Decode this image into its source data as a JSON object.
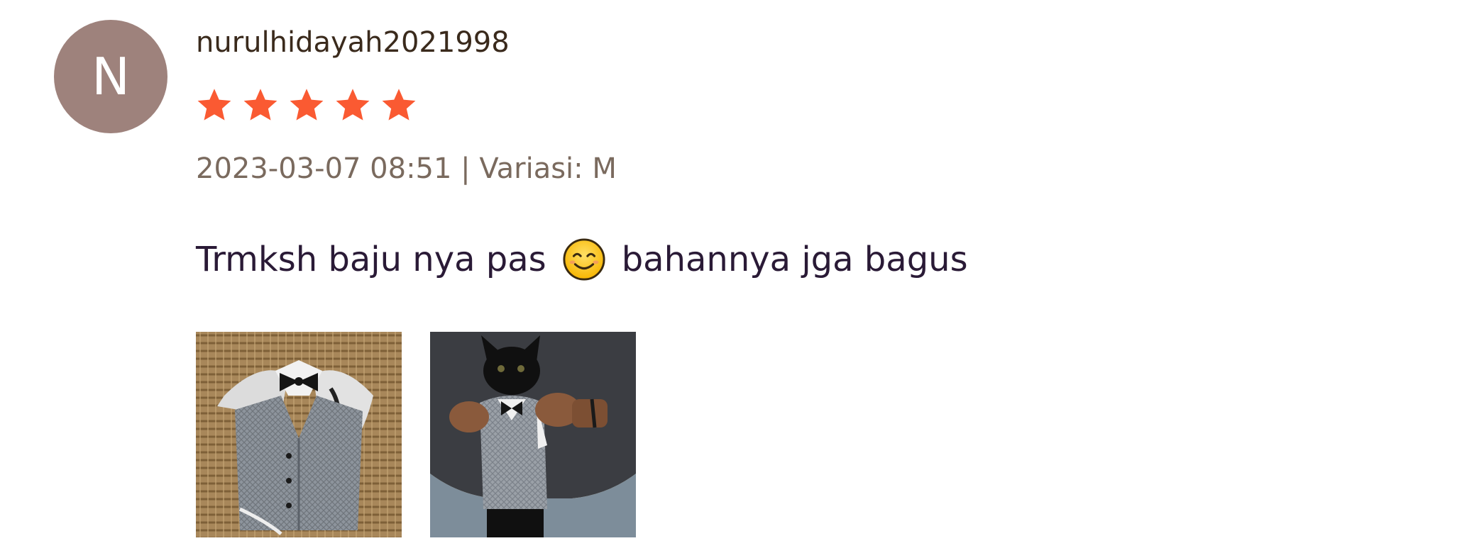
{
  "review": {
    "avatar_letter": "N",
    "username": "nurulhidayah2021998",
    "rating": 5,
    "date": "2023-03-07 08:51",
    "separator": "|",
    "variation": "Variasi: M",
    "comment_part1": "Trmksh baju nya pas",
    "comment_emoji": "smiling-face-icon",
    "comment_part2": "bahannya jga bagus",
    "photos": [
      {
        "name": "review-photo-1"
      },
      {
        "name": "review-photo-2"
      }
    ]
  },
  "colors": {
    "avatar_bg": "#9e827c",
    "star": "#fa5a32",
    "username": "#3a2a1c",
    "meta": "#7a6a5e",
    "comment": "#2a1a36"
  }
}
